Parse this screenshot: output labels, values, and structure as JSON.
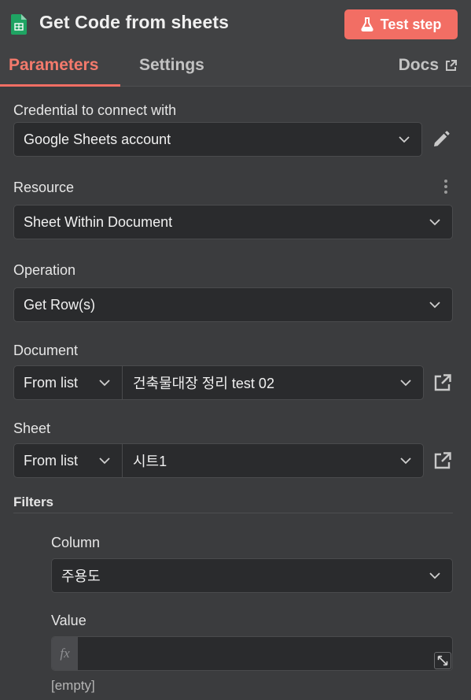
{
  "header": {
    "title": "Get Code from sheets",
    "test_button": "Test step",
    "icon": "google-sheets-icon",
    "accent": "#f26e64"
  },
  "tabs": {
    "parameters": "Parameters",
    "settings": "Settings",
    "docs": "Docs"
  },
  "form": {
    "credential": {
      "label": "Credential to connect with",
      "value": "Google Sheets account"
    },
    "resource": {
      "label": "Resource",
      "value": "Sheet Within Document"
    },
    "operation": {
      "label": "Operation",
      "value": "Get Row(s)"
    },
    "document": {
      "label": "Document",
      "mode": "From list",
      "value": "건축물대장 정리 test 02"
    },
    "sheet": {
      "label": "Sheet",
      "mode": "From list",
      "value": "시트1"
    },
    "filters": {
      "label": "Filters",
      "column": {
        "label": "Column",
        "value": "주용도"
      },
      "value": {
        "label": "Value",
        "fx": "fx",
        "hint": "[empty]"
      }
    }
  }
}
